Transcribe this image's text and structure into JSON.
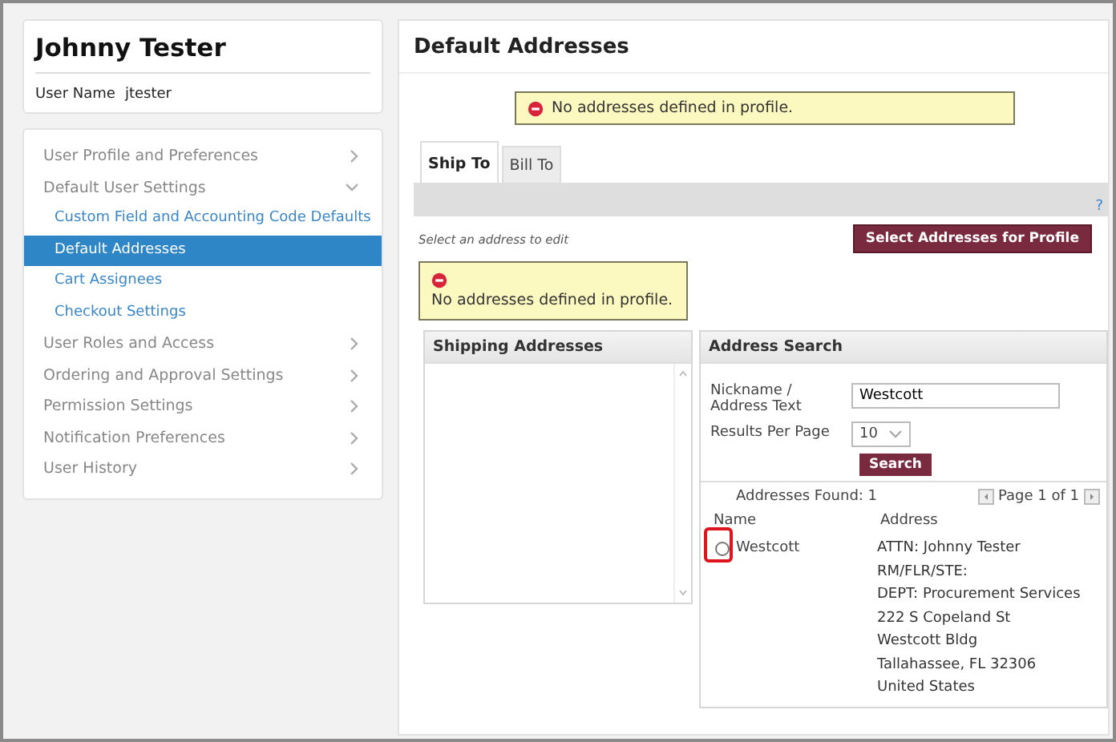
{
  "user": {
    "name": "Johnny Tester",
    "username_label": "User Name",
    "username": "jtester"
  },
  "nav": [
    {
      "label": "User Profile and Preferences",
      "expanded": false
    },
    {
      "label": "Default User Settings",
      "expanded": true,
      "children": [
        {
          "label": "Custom Field and Accounting Code Defaults",
          "selected": false
        },
        {
          "label": "Default Addresses",
          "selected": true
        },
        {
          "label": "Cart Assignees",
          "selected": false
        },
        {
          "label": "Checkout Settings",
          "selected": false
        }
      ]
    },
    {
      "label": "User Roles and Access",
      "expanded": false
    },
    {
      "label": "Ordering and Approval Settings",
      "expanded": false
    },
    {
      "label": "Permission Settings",
      "expanded": false
    },
    {
      "label": "Notification Preferences",
      "expanded": false
    },
    {
      "label": "User History",
      "expanded": false
    }
  ],
  "main": {
    "title": "Default Addresses",
    "alert": "No addresses defined in profile.",
    "tabs": [
      {
        "label": "Ship To",
        "selected": true
      },
      {
        "label": "Bill To",
        "selected": false
      }
    ],
    "help": "?",
    "hint": "Select an address to edit",
    "select_button": "Select Addresses for Profile",
    "inner_alert": "No addresses defined in profile.",
    "shipping_panel": {
      "title": "Shipping Addresses"
    },
    "search_panel": {
      "title": "Address Search",
      "nickname_label": "Nickname / Address Text",
      "nickname_value": "Westcott",
      "results_label": "Results Per Page",
      "results_value": "10",
      "search_button": "Search",
      "found": "Addresses Found: 1",
      "pager": "Page 1 of 1",
      "columns": [
        "Name",
        "Address"
      ],
      "rows": [
        {
          "selected": false,
          "highlighted": true,
          "name": "Westcott",
          "address": [
            "ATTN: Johnny Tester",
            "RM/FLR/STE:",
            "DEPT: Procurement Services",
            "222 S Copeland St",
            "Westcott Bldg",
            "Tallahassee, FL 32306",
            "United States"
          ]
        }
      ]
    }
  }
}
